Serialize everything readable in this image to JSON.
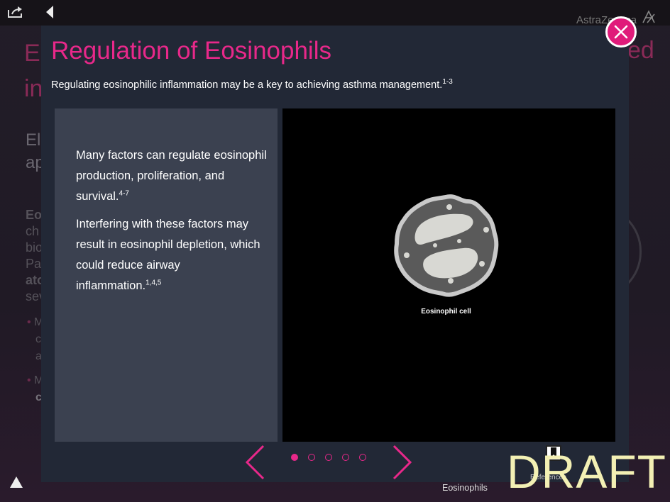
{
  "app": {
    "brand": "AstraZeneca",
    "background_title_left": "E",
    "background_title_left2": "in",
    "background_title_right": "ed",
    "background_subtitle": [
      "El",
      "ap"
    ],
    "background_text": [
      "Eo",
      "ch",
      "bio",
      "Pa",
      "ato",
      "sev"
    ],
    "background_bullets": [
      "M",
      "c",
      "a",
      "M",
      "c"
    ]
  },
  "modal": {
    "title": "Regulation of Eosinophils",
    "subtitle": "Regulating eosinophilic inflammation may be a key to achieving asthma management.",
    "subtitle_sup": "1-3",
    "paragraph1": "Many factors can regulate eosinophil production, proliferation, and survival.",
    "paragraph1_sup": "4-7",
    "paragraph2": "Interfering with these factors may result in eosinophil depletion, which could reduce airway inflammation.",
    "paragraph2_sup": "1,4,5",
    "image_label": "Eosinophil cell"
  },
  "pager": {
    "current": 1,
    "total": 5
  },
  "footer": {
    "references_label": "References",
    "section_label": "Eosinophils",
    "watermark": "DRAFT"
  },
  "colors": {
    "accent": "#e8288a",
    "close": "#e01b7a",
    "modal_bg": "#222836",
    "panel_bg": "#3b4150",
    "watermark": "#f3f0b4"
  }
}
